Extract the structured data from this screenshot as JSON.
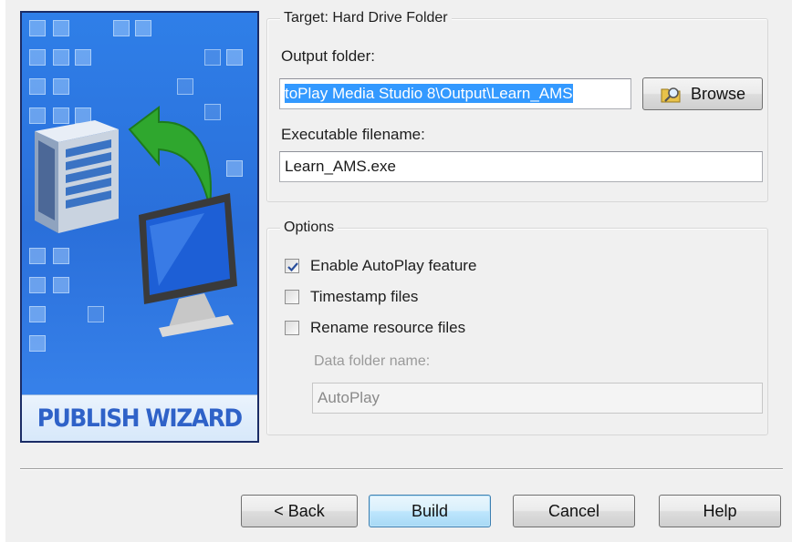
{
  "banner": {
    "label": "PUBLISH WIZARD"
  },
  "target_group": {
    "title": "Target: Hard Drive Folder",
    "output_folder_label": "Output folder:",
    "output_folder_value": "toPlay Media Studio 8\\Output\\Learn_AMS",
    "browse_label": "Browse",
    "browse_icon": "folder-search-icon",
    "exe_label": "Executable filename:",
    "exe_value": "Learn_AMS.exe"
  },
  "options_group": {
    "title": "Options",
    "enable_autoplay": {
      "label": "Enable AutoPlay feature",
      "checked": true
    },
    "timestamp_files": {
      "label": "Timestamp files",
      "checked": false
    },
    "rename_resource": {
      "label": "Rename resource files",
      "checked": false
    },
    "data_folder_label": "Data folder name:",
    "data_folder_value": "AutoPlay"
  },
  "footer": {
    "back_label": "< Back",
    "build_label": "Build",
    "cancel_label": "Cancel",
    "help_label": "Help"
  },
  "colors": {
    "banner_blue": "#2a6fda",
    "banner_text": "#2f62c8",
    "selection": "#3399ff",
    "dialog_bg": "#f0f0f0"
  }
}
